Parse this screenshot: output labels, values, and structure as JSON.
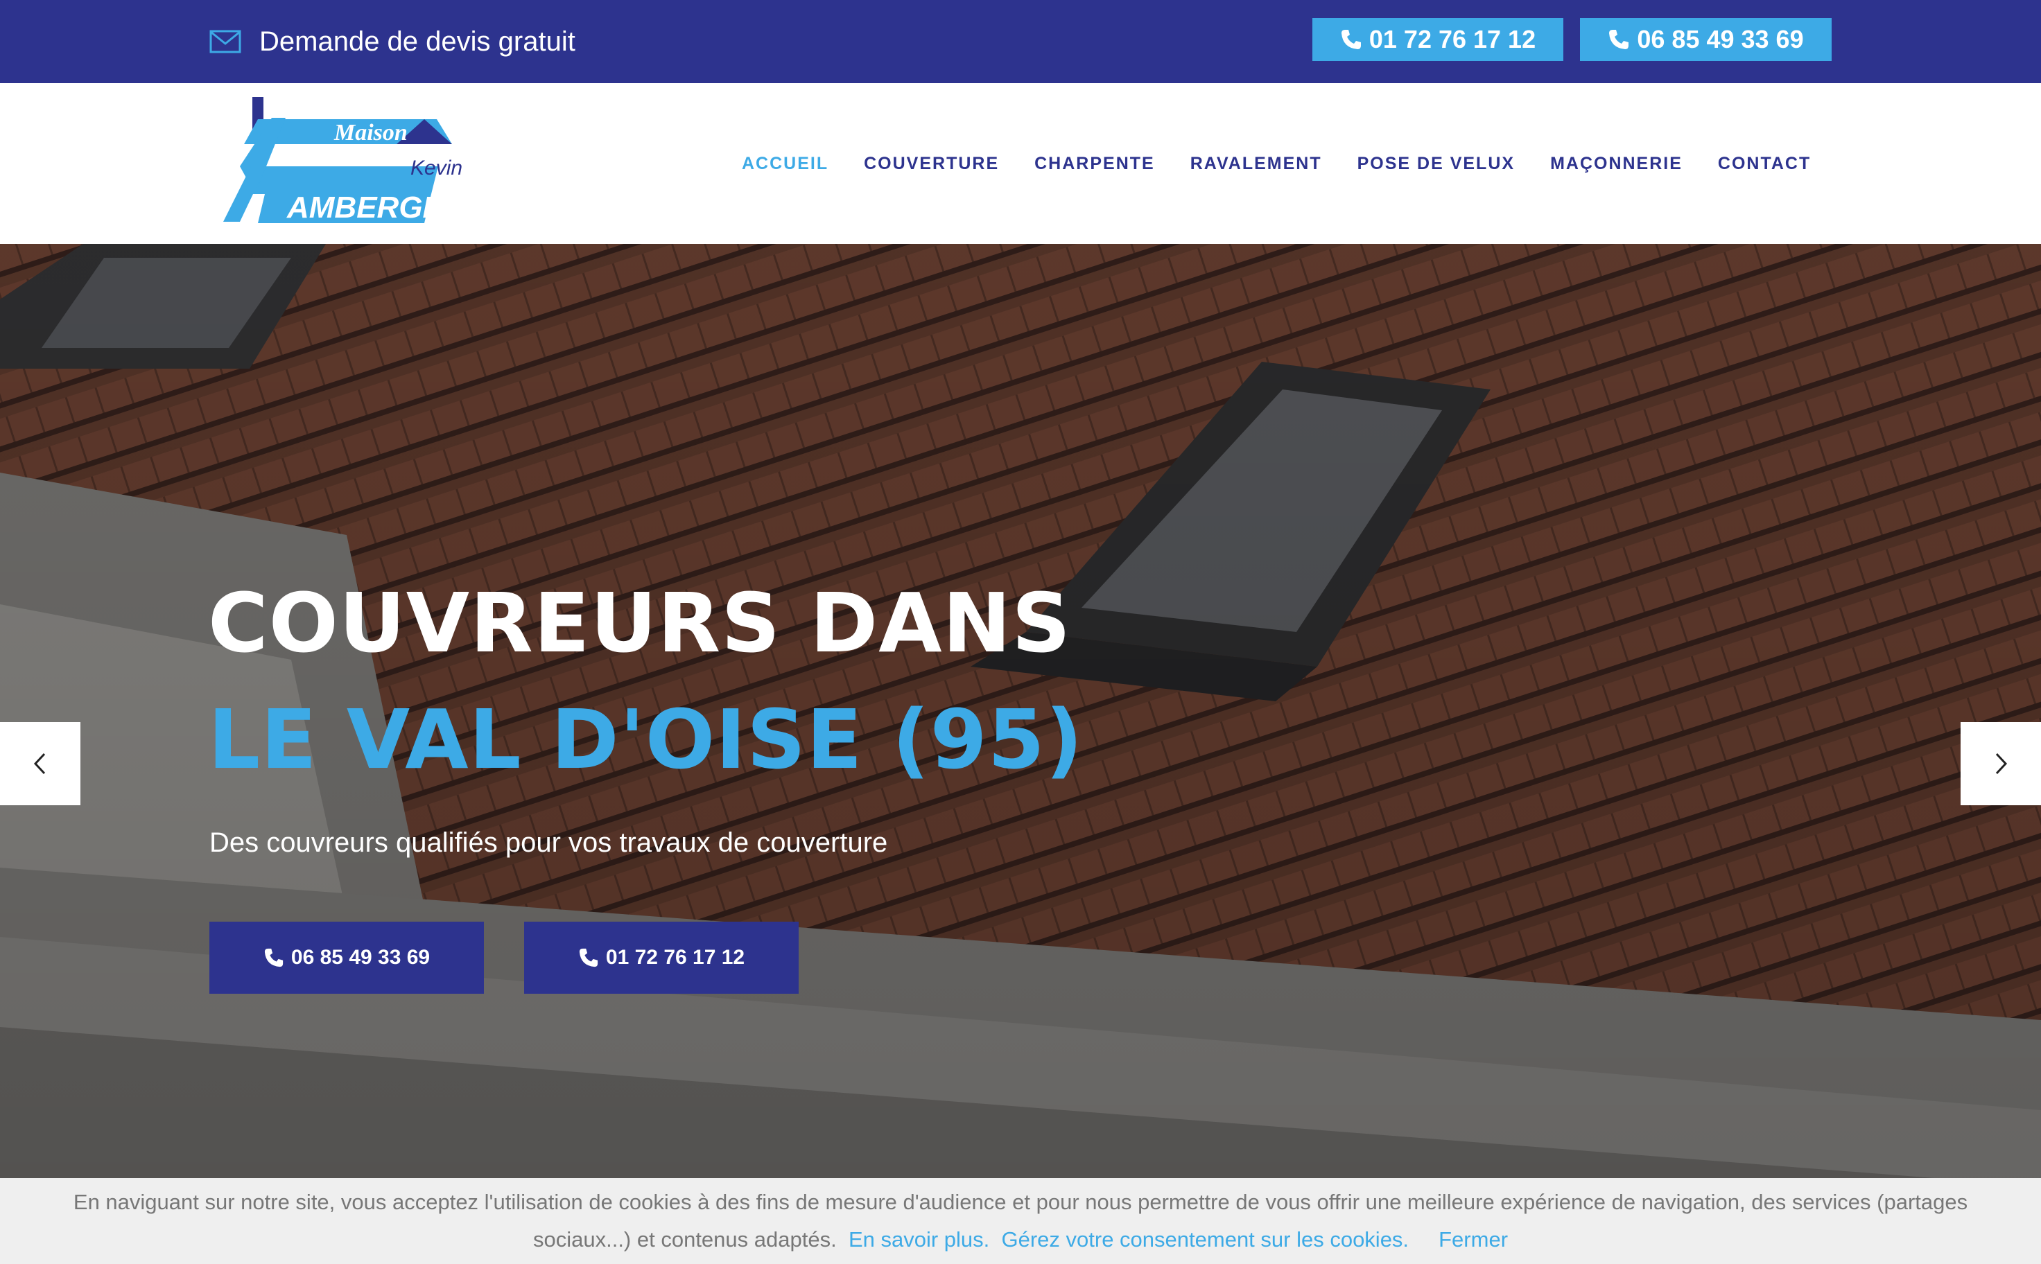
{
  "topbar": {
    "quote_label": "Demande de devis gratuit",
    "phone1": "01 72 76 17 12",
    "phone2": "06 85 49 33 69"
  },
  "logo": {
    "line1": "Maison",
    "line2": "Kevin",
    "line3": "AMBERGIER"
  },
  "nav": {
    "items": [
      "ACCUEIL",
      "COUVERTURE",
      "CHARPENTE",
      "RAVALEMENT",
      "POSE DE VELUX",
      "MAÇONNERIE",
      "CONTACT"
    ],
    "active": "ACCUEIL"
  },
  "hero": {
    "title_line1": "COUVREURS DANS",
    "title_line2": "LE VAL D'OISE (95)",
    "subtitle": "Des couvreurs qualifiés pour vos travaux de couverture",
    "button1": "06 85 49 33 69",
    "button2": "01 72 76 17 12"
  },
  "cookie": {
    "text": "En naviguant sur notre site, vous acceptez l'utilisation de cookies à des fins de mesure d'audience et pour nous permettre de vous offrir une meilleure expérience de navigation, des services (partages sociaux...) et contenus adaptés.",
    "learn_more": "En savoir plus.",
    "manage": "Gérez votre consentement sur les cookies.",
    "close": "Fermer"
  },
  "colors": {
    "primary": "#2d338e",
    "accent": "#3daae6",
    "cookie_bg": "#efefef"
  },
  "icons": [
    "mail-icon",
    "phone-icon",
    "chevron-left-icon",
    "chevron-right-icon"
  ]
}
